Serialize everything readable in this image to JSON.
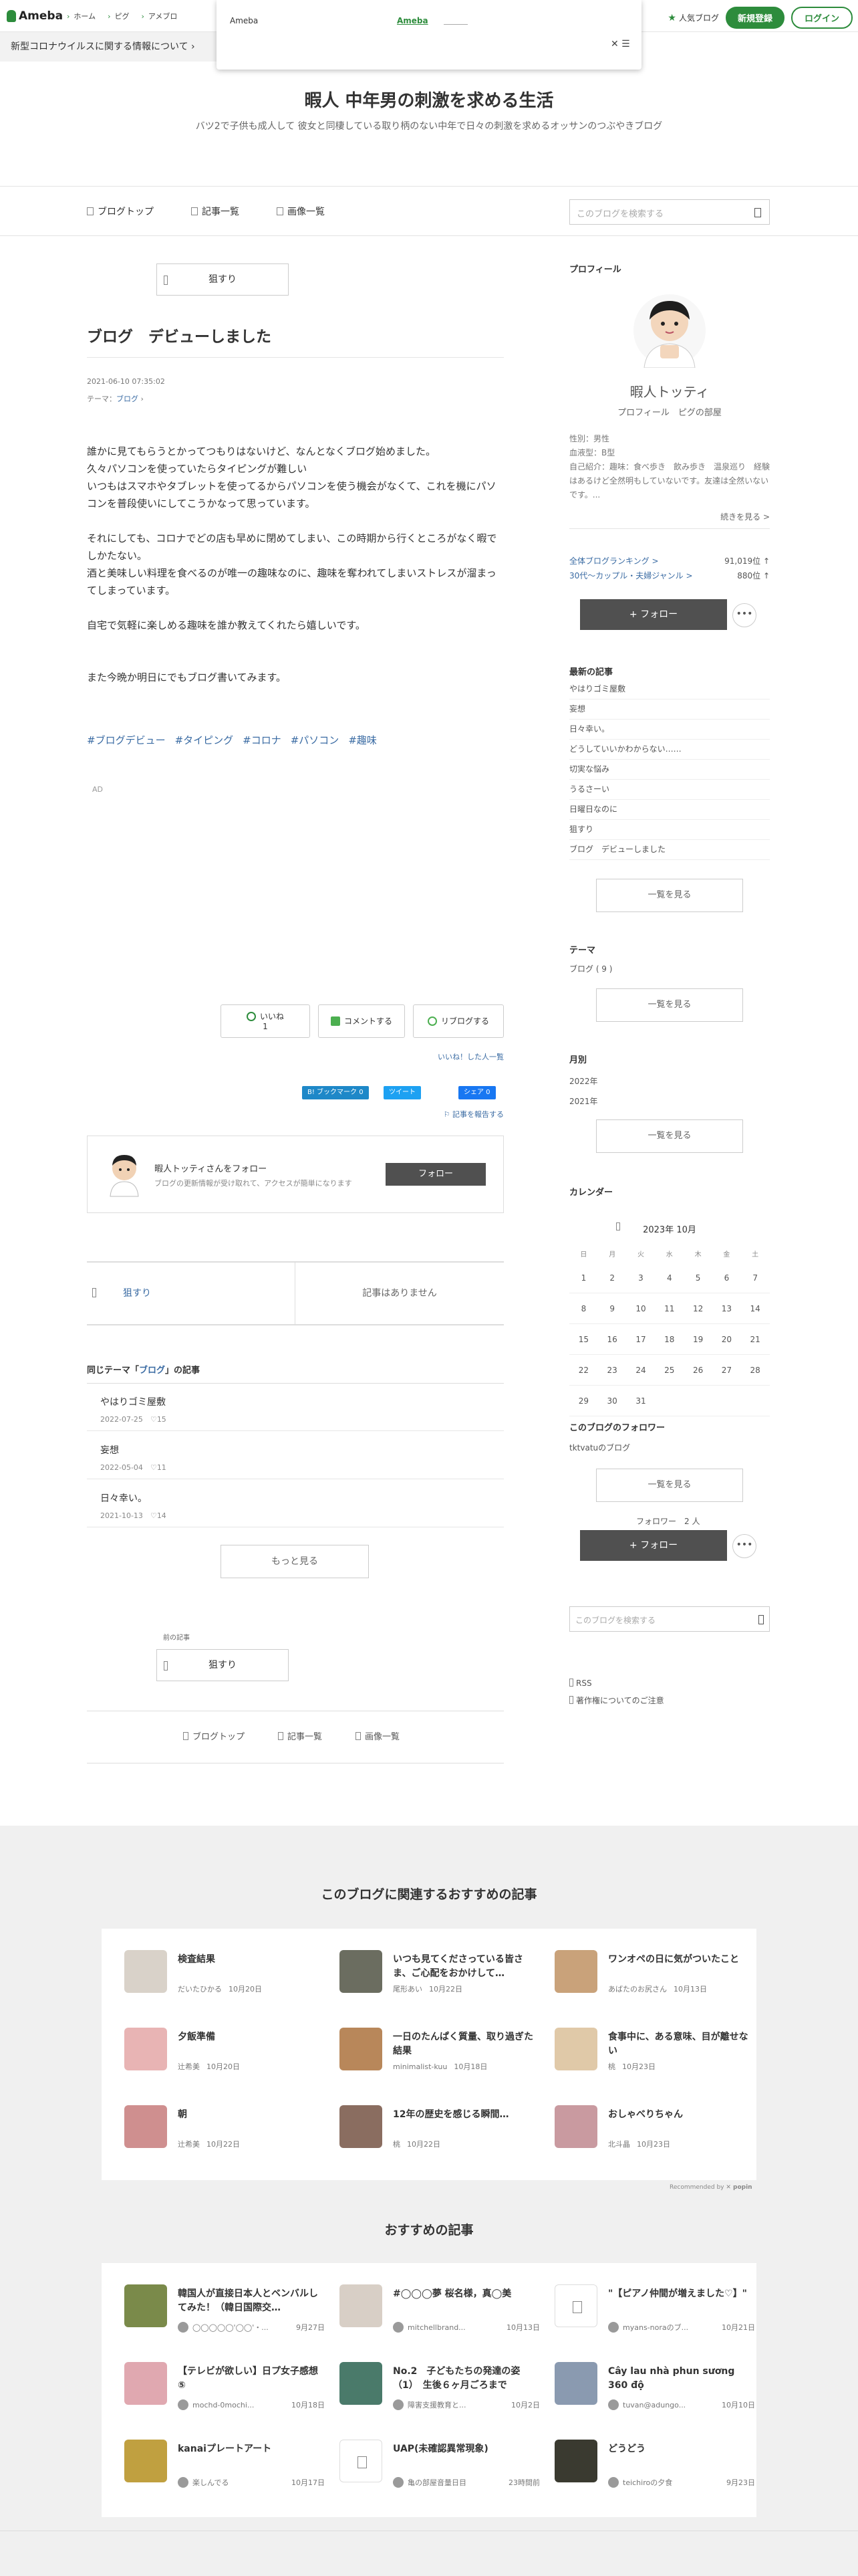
{
  "topbar": {
    "logo": "Ameba",
    "nav": [
      "ホーム",
      "ピグ",
      "アメブロ"
    ],
    "popular_blog": "人気ブログ",
    "register": "新規登録",
    "login": "ログイン"
  },
  "popup": {
    "name": "Ameba",
    "brand": "Ameba",
    "close": "✕ ☰"
  },
  "notice": "新型コロナウイルスに関する情報について",
  "blog": {
    "title": "暇人 中年男の刺激を求める生活",
    "description": "バツ2で子供も成人して 彼女と同棲している取り柄のない中年で日々の刺激を求めるオッサンのつぶやきブログ"
  },
  "gnav": [
    "ブログトップ",
    "記事一覧",
    "画像一覧"
  ],
  "search_placeholder": "このブログを検索する",
  "article": {
    "prev_button": "狙すり",
    "title": "ブログ　デビューしました",
    "date": "2021-06-10 07:35:02",
    "theme_label": "テーマ：",
    "theme": "ブログ",
    "paragraphs": [
      "誰かに見てもらうとかってつもりはないけど、なんとなくブログ始めました。",
      "久々パソコンを使っていたらタイピングが難しい",
      "いつもはスマホやタブレットを使ってるからパソコンを使う機会がなくて、これを機にパソコンを普段使いにしてこうかなって思っています。",
      "",
      "それにしても、コロナでどの店も早めに閉めてしまい、この時期から行くところがなく暇でしかたない。",
      "酒と美味しい料理を食べるのが唯一の趣味なのに、趣味を奪われてしまいストレスが溜まってしまっています。",
      "",
      "自宅で気軽に楽しめる趣味を誰か教えてくれたら嬉しいです。",
      "",
      "",
      "また今晩か明日にでもブログ書いてみます。"
    ],
    "hashtags": [
      "#ブログデビュー",
      "#タイピング",
      "#コロナ",
      "#パソコン",
      "#趣味"
    ],
    "ad": "AD"
  },
  "reactions": {
    "like": "いいね",
    "like_count": "1",
    "comment": "コメントする",
    "reblog": "リブログする",
    "like_list": "いいね！した人一覧"
  },
  "share": {
    "hatena": "B! ブックマーク 0",
    "twitter": "ツイート",
    "facebook": "シェア 0"
  },
  "report": "記事を報告する",
  "follow_box": {
    "name": "暇人トッティさんをフォロー",
    "desc": "ブログの更新情報が受け取れて、アクセスが簡単になります",
    "button": "フォロー"
  },
  "nav_pair": {
    "prev": "狙すり",
    "next": "記事はありません"
  },
  "same_theme": {
    "prefix": "同じテーマ「",
    "theme": "ブログ",
    "suffix": "」の記事",
    "items": [
      {
        "title": "やはりゴミ屋敷",
        "date": "2022-07-25",
        "count": "15"
      },
      {
        "title": "妄想",
        "date": "2022-05-04",
        "count": "11"
      },
      {
        "title": "日々幸い。",
        "date": "2021-10-13",
        "count": "14"
      }
    ],
    "more": "もっと見る"
  },
  "prev_article": {
    "label": "前の記事",
    "button": "狙すり"
  },
  "sidebar": {
    "profile_heading": "プロフィール",
    "name": "暇人トッティ",
    "blog_link": "プロフィール　ピグの部屋",
    "info": [
      "性別：男性",
      "血液型：B型",
      "自己紹介：趣味：食べ歩き　飲み歩き　温泉巡り　経験はあるけど全然明もしていないです。友達は全然いないです。..."
    ],
    "more": "続きを見る >",
    "ranks": [
      {
        "label": "全体ブログランキング >",
        "value": "91,019位 ↑"
      },
      {
        "label": "30代〜カップル・夫婦ジャンル >",
        "value": "880位 ↑"
      }
    ],
    "follow": "+ フォロー",
    "dots": "•••",
    "recent_heading": "最新の記事",
    "recent": [
      "やはりゴミ屋敷",
      "妄想",
      "日々幸い。",
      "どうしていいかわからない……",
      "切実な悩み",
      "うるさーい",
      "日曜日なのに",
      "狙すり",
      "ブログ　デビューしました"
    ],
    "list_all": "一覧を見る",
    "theme_heading": "テーマ",
    "theme_item": "ブログ ( 9 )",
    "month_heading": "月別",
    "months": [
      "2022年",
      "2021年"
    ],
    "calendar_heading": "カレンダー",
    "calendar_title": "2023年 10月",
    "weekdays": [
      "日",
      "月",
      "火",
      "水",
      "木",
      "金",
      "土"
    ],
    "weeks": [
      [
        "1",
        "2",
        "3",
        "4",
        "5",
        "6",
        "7"
      ],
      [
        "8",
        "9",
        "10",
        "11",
        "12",
        "13",
        "14"
      ],
      [
        "15",
        "16",
        "17",
        "18",
        "19",
        "20",
        "21"
      ],
      [
        "22",
        "23",
        "24",
        "25",
        "26",
        "27",
        "28"
      ],
      [
        "29",
        "30",
        "31",
        "",
        "",
        "",
        ""
      ]
    ],
    "followers_heading": "このブログのフォロワー",
    "follower": "tktvatuのブログ",
    "follower_count": "フォロワー　2 人",
    "rss": "RSS",
    "copyright": "著作権についてのご注意"
  },
  "rec1": {
    "title": "このブログに関連するおすすめの記事",
    "items": [
      {
        "title": "検査結果",
        "author": "だいたひかる",
        "date": "10月20日",
        "color": "#d9d2c9"
      },
      {
        "title": "いつも見てくださっている皆さま、ご心配をおかけして…",
        "author": "尾形あい",
        "date": "10月22日",
        "color": "#6b6d60"
      },
      {
        "title": "ワンオペの日に気がついたこと",
        "author": "あばたのお尻さん",
        "date": "10月13日",
        "color": "#c9a27a"
      },
      {
        "title": "夕飯準備",
        "author": "辻希美",
        "date": "10月20日",
        "color": "#e8b4b4"
      },
      {
        "title": "一日のたんぱく質量、取り過ぎた結果",
        "author": "minimalist-kuu",
        "date": "10月18日",
        "color": "#b8875a"
      },
      {
        "title": "食事中に、ある意味、目が離せない",
        "author": "桃",
        "date": "10月23日",
        "color": "#e0c9a8"
      },
      {
        "title": "朝",
        "author": "辻希美",
        "date": "10月22日",
        "color": "#cf8f8f"
      },
      {
        "title": "12年の歴史を感じる瞬間…",
        "author": "桃",
        "date": "10月22日",
        "color": "#8a6d60"
      },
      {
        "title": "おしゃべりちゃん",
        "author": "北斗晶",
        "date": "10月23日",
        "color": "#c99aa0"
      }
    ],
    "powered": "Recommended by"
  },
  "rec2": {
    "title": "おすすめの記事",
    "items": [
      {
        "title": "韓国人が直接日本人とベンバルしてみた！（韓日国際交…",
        "author": "◯◯◯◯◯'◯◯'・...",
        "date": "9月27日",
        "color": "#7a8a4a",
        "doc": false
      },
      {
        "title": "#◯◯◯夢 桜名様，真◯美",
        "author": "mitchellbrand...",
        "date": "10月13日",
        "color": "#d8cfc6",
        "doc": false
      },
      {
        "title": "\"【ピアノ仲間が増えました♡】\"",
        "author": "myans-noraのブ...",
        "date": "10月21日",
        "color": "#ffffff",
        "doc": true
      },
      {
        "title": "【テレビが欲しい】日プ女子感想⑤",
        "author": "mochd-0mochi...",
        "date": "10月18日",
        "color": "#e0a8b0",
        "doc": false
      },
      {
        "title": "No.2　子どもたちの発達の姿（1）　生後６ヶ月ごろまで",
        "author": "障害支援教育と...",
        "date": "10月2日",
        "color": "#4a7a6a",
        "doc": false
      },
      {
        "title": "Cây lau nhà phun sương 360 độ",
        "author": "tuvan@adungo...",
        "date": "10月10日",
        "color": "#8a9ab0",
        "doc": false
      },
      {
        "title": "kanaiプレートアート",
        "author": "楽しんでる",
        "date": "10月17日",
        "color": "#c0a040",
        "doc": false
      },
      {
        "title": "UAP(未確認異常現象)",
        "author": "亀の部屋音量日目",
        "date": "23時間前",
        "color": "#ffffff",
        "doc": true
      },
      {
        "title": "どうどう",
        "author": "teichiroの夕食",
        "date": "9月23日",
        "color": "#3a3a30",
        "doc": false
      }
    ]
  }
}
